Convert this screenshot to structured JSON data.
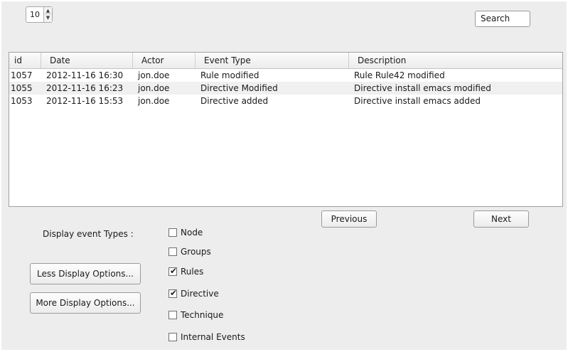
{
  "pager": {
    "page_size": "10"
  },
  "search": {
    "label": "Search"
  },
  "table": {
    "columns": [
      "id",
      "Date",
      "Actor",
      "Event Type",
      "Description"
    ],
    "rows": [
      [
        "1057",
        "2012-11-16 16:30",
        "jon.doe",
        "Rule modified",
        "Rule Rule42 modified"
      ],
      [
        "1055",
        "2012-11-16 16:23",
        "jon.doe",
        "Directive Modified",
        "Directive install emacs modified"
      ],
      [
        "1053",
        "2012-11-16 15:53",
        "jon.doe",
        "Directive added",
        "Directive install emacs added"
      ]
    ]
  },
  "pagination": {
    "previous": "Previous",
    "next": "Next"
  },
  "filters": {
    "title": "Display event Types :",
    "items": [
      {
        "label": "Node",
        "checked": false
      },
      {
        "label": "Groups",
        "checked": false
      },
      {
        "label": "Rules",
        "checked": true
      },
      {
        "label": "Directive",
        "checked": true
      },
      {
        "label": "Technique",
        "checked": false
      },
      {
        "label": "Internal Events",
        "checked": false
      }
    ]
  },
  "options": {
    "less": "Less Display Options...",
    "more": "More Display Options..."
  }
}
